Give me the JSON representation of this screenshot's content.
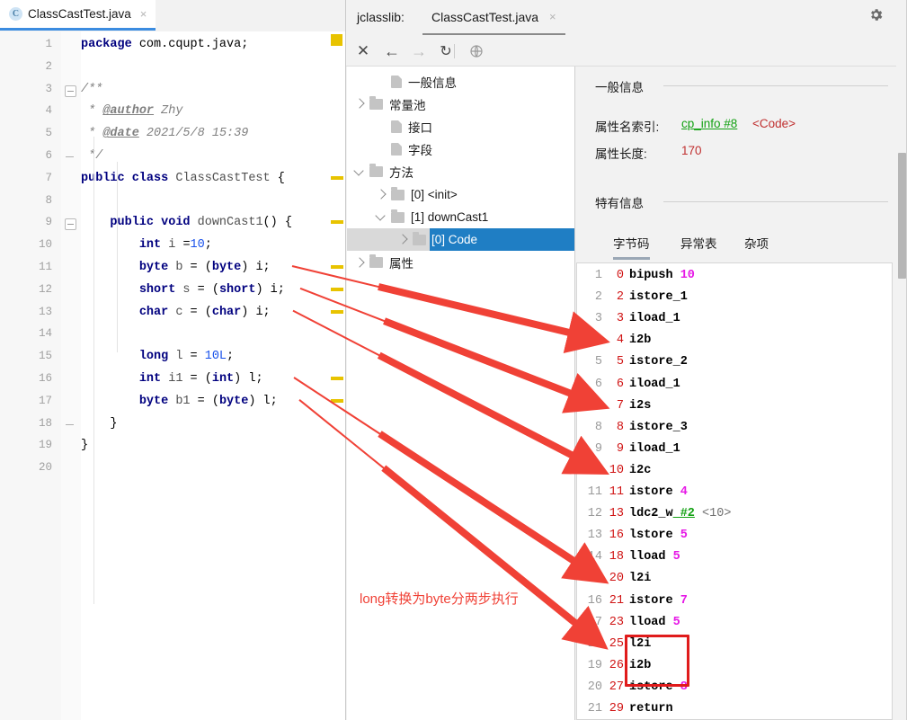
{
  "editor": {
    "tab": {
      "label": "ClassCastTest.java",
      "icon": "class-icon",
      "letter": "C",
      "close": "×"
    },
    "line_numbers": [
      "1",
      "2",
      "3",
      "4",
      "5",
      "6",
      "7",
      "8",
      "9",
      "10",
      "11",
      "12",
      "13",
      "14",
      "15",
      "16",
      "17",
      "18",
      "19",
      "20"
    ],
    "code_lines": [
      {
        "n": 1,
        "segs": [
          {
            "t": "package",
            "c": "kw"
          },
          {
            "t": " com.cqupt.java;",
            "c": "pl"
          }
        ]
      },
      {
        "n": 2,
        "segs": []
      },
      {
        "n": 3,
        "segs": [
          {
            "t": "/**",
            "c": "cmt"
          }
        ]
      },
      {
        "n": 4,
        "segs": [
          {
            "t": " * ",
            "c": "cmt"
          },
          {
            "t": "@author",
            "c": "cmt-u"
          },
          {
            "t": " Zhy",
            "c": "cmt"
          }
        ]
      },
      {
        "n": 5,
        "segs": [
          {
            "t": " * ",
            "c": "cmt"
          },
          {
            "t": "@date",
            "c": "cmt-u"
          },
          {
            "t": " 2021/5/8 15:39",
            "c": "cmt"
          }
        ]
      },
      {
        "n": 6,
        "segs": [
          {
            "t": " */",
            "c": "cmt"
          }
        ]
      },
      {
        "n": 7,
        "segs": [
          {
            "t": "public class",
            "c": "kw"
          },
          {
            "t": " ClassCastTest ",
            "c": "id"
          },
          {
            "t": "{",
            "c": "pl"
          }
        ]
      },
      {
        "n": 8,
        "segs": []
      },
      {
        "n": 9,
        "segs": [
          {
            "t": "    ",
            "c": "pl"
          },
          {
            "t": "public void",
            "c": "kw"
          },
          {
            "t": " downCast1",
            "c": "id"
          },
          {
            "t": "() {",
            "c": "pl"
          }
        ]
      },
      {
        "n": 10,
        "segs": [
          {
            "t": "        ",
            "c": "pl"
          },
          {
            "t": "int",
            "c": "kw"
          },
          {
            "t": " i ",
            "c": "id"
          },
          {
            "t": "=",
            "c": "pl"
          },
          {
            "t": "10",
            "c": "num"
          },
          {
            "t": ";",
            "c": "pl"
          }
        ]
      },
      {
        "n": 11,
        "segs": [
          {
            "t": "        ",
            "c": "pl"
          },
          {
            "t": "byte",
            "c": "kw"
          },
          {
            "t": " b ",
            "c": "id"
          },
          {
            "t": "= (",
            "c": "pl"
          },
          {
            "t": "byte",
            "c": "kw"
          },
          {
            "t": ") i;",
            "c": "pl"
          }
        ]
      },
      {
        "n": 12,
        "segs": [
          {
            "t": "        ",
            "c": "pl"
          },
          {
            "t": "short",
            "c": "kw"
          },
          {
            "t": " s ",
            "c": "id"
          },
          {
            "t": "= (",
            "c": "pl"
          },
          {
            "t": "short",
            "c": "kw"
          },
          {
            "t": ") i;",
            "c": "pl"
          }
        ]
      },
      {
        "n": 13,
        "segs": [
          {
            "t": "        ",
            "c": "pl"
          },
          {
            "t": "char",
            "c": "kw"
          },
          {
            "t": " c ",
            "c": "id"
          },
          {
            "t": "= (",
            "c": "pl"
          },
          {
            "t": "char",
            "c": "kw"
          },
          {
            "t": ") i;",
            "c": "pl"
          }
        ]
      },
      {
        "n": 14,
        "segs": []
      },
      {
        "n": 15,
        "segs": [
          {
            "t": "        ",
            "c": "pl"
          },
          {
            "t": "long",
            "c": "kw"
          },
          {
            "t": " l ",
            "c": "id"
          },
          {
            "t": "= ",
            "c": "pl"
          },
          {
            "t": "10L",
            "c": "num"
          },
          {
            "t": ";",
            "c": "pl"
          }
        ]
      },
      {
        "n": 16,
        "segs": [
          {
            "t": "        ",
            "c": "pl"
          },
          {
            "t": "int",
            "c": "kw"
          },
          {
            "t": " i1 ",
            "c": "id"
          },
          {
            "t": "= (",
            "c": "pl"
          },
          {
            "t": "int",
            "c": "kw"
          },
          {
            "t": ") l;",
            "c": "pl"
          }
        ]
      },
      {
        "n": 17,
        "segs": [
          {
            "t": "        ",
            "c": "pl"
          },
          {
            "t": "byte",
            "c": "kw"
          },
          {
            "t": " b1 ",
            "c": "id"
          },
          {
            "t": "= (",
            "c": "pl"
          },
          {
            "t": "byte",
            "c": "kw"
          },
          {
            "t": ") l;",
            "c": "pl"
          }
        ]
      },
      {
        "n": 18,
        "segs": [
          {
            "t": "    }",
            "c": "pl"
          }
        ]
      },
      {
        "n": 19,
        "segs": [
          {
            "t": "}",
            "c": "pl"
          }
        ]
      },
      {
        "n": 20,
        "segs": []
      }
    ],
    "caret_line": 20,
    "gutter_marker_color": "#e8c300"
  },
  "jclasslib": {
    "title": "jclasslib:",
    "file_tab": {
      "label": "ClassCastTest.java",
      "close": "×"
    },
    "window_buttons": [
      {
        "name": "settings",
        "icon": "gear-icon"
      },
      {
        "name": "minimize",
        "icon": "minimize-icon"
      }
    ],
    "toolbar": [
      {
        "name": "close",
        "icon": "close-icon",
        "glyph": "✕",
        "enabled": true
      },
      {
        "name": "back",
        "icon": "arrow-left-icon",
        "glyph": "←",
        "enabled": true
      },
      {
        "name": "forward",
        "icon": "arrow-right-icon",
        "glyph": "→",
        "enabled": false
      },
      {
        "name": "reload",
        "icon": "refresh-icon",
        "glyph": "↻",
        "enabled": true
      },
      {
        "name": "browse",
        "icon": "globe-icon",
        "glyph": "◌",
        "enabled": true
      }
    ],
    "tree": [
      {
        "label": "一般信息",
        "indent": 1,
        "twisty": "none",
        "icon": "doc",
        "selected": false
      },
      {
        "label": "常量池",
        "indent": 0,
        "twisty": "right",
        "icon": "folder",
        "selected": false
      },
      {
        "label": "接口",
        "indent": 1,
        "twisty": "none",
        "icon": "doc",
        "selected": false
      },
      {
        "label": "字段",
        "indent": 1,
        "twisty": "none",
        "icon": "doc",
        "selected": false
      },
      {
        "label": "方法",
        "indent": 0,
        "twisty": "down",
        "icon": "folder",
        "selected": false
      },
      {
        "label": "[0] <init>",
        "indent": 1,
        "twisty": "right",
        "icon": "folder",
        "selected": false
      },
      {
        "label": "[1] downCast1",
        "indent": 1,
        "twisty": "down",
        "icon": "folder",
        "selected": false
      },
      {
        "label": "[0] Code",
        "indent": 2,
        "twisty": "right",
        "icon": "folder",
        "selected": true
      },
      {
        "label": "属性",
        "indent": 0,
        "twisty": "right",
        "icon": "folder",
        "selected": false
      }
    ],
    "detail": {
      "general_section": "一般信息",
      "attr_name_label": "属性名索引:",
      "attr_name_link": "cp_info #8",
      "attr_name_value": "<Code>",
      "attr_len_label": "属性长度:",
      "attr_len_value": "170",
      "specific_section": "特有信息",
      "tabs": [
        {
          "label": "字节码",
          "active": true
        },
        {
          "label": "异常表",
          "active": false
        },
        {
          "label": "杂项",
          "active": false
        }
      ]
    },
    "bytecode": [
      {
        "no": "1",
        "off": "0",
        "op": "bipush",
        "arg": "10",
        "ref": "",
        "cmt": ""
      },
      {
        "no": "2",
        "off": "2",
        "op": "istore_1",
        "arg": "",
        "ref": "",
        "cmt": ""
      },
      {
        "no": "3",
        "off": "3",
        "op": "iload_1",
        "arg": "",
        "ref": "",
        "cmt": ""
      },
      {
        "no": "4",
        "off": "4",
        "op": "i2b",
        "arg": "",
        "ref": "",
        "cmt": ""
      },
      {
        "no": "5",
        "off": "5",
        "op": "istore_2",
        "arg": "",
        "ref": "",
        "cmt": ""
      },
      {
        "no": "6",
        "off": "6",
        "op": "iload_1",
        "arg": "",
        "ref": "",
        "cmt": ""
      },
      {
        "no": "7",
        "off": "7",
        "op": "i2s",
        "arg": "",
        "ref": "",
        "cmt": ""
      },
      {
        "no": "8",
        "off": "8",
        "op": "istore_3",
        "arg": "",
        "ref": "",
        "cmt": ""
      },
      {
        "no": "9",
        "off": "9",
        "op": "iload_1",
        "arg": "",
        "ref": "",
        "cmt": ""
      },
      {
        "no": "10",
        "off": "10",
        "op": "i2c",
        "arg": "",
        "ref": "",
        "cmt": ""
      },
      {
        "no": "11",
        "off": "11",
        "op": "istore",
        "arg": "4",
        "ref": "",
        "cmt": ""
      },
      {
        "no": "12",
        "off": "13",
        "op": "ldc2_w",
        "arg": "",
        "ref": "#2",
        "cmt": "<10>"
      },
      {
        "no": "13",
        "off": "16",
        "op": "lstore",
        "arg": "5",
        "ref": "",
        "cmt": ""
      },
      {
        "no": "14",
        "off": "18",
        "op": "lload",
        "arg": "5",
        "ref": "",
        "cmt": ""
      },
      {
        "no": "15",
        "off": "20",
        "op": "l2i",
        "arg": "",
        "ref": "",
        "cmt": ""
      },
      {
        "no": "16",
        "off": "21",
        "op": "istore",
        "arg": "7",
        "ref": "",
        "cmt": ""
      },
      {
        "no": "17",
        "off": "23",
        "op": "lload",
        "arg": "5",
        "ref": "",
        "cmt": ""
      },
      {
        "no": "18",
        "off": "25",
        "op": "l2i",
        "arg": "",
        "ref": "",
        "cmt": ""
      },
      {
        "no": "19",
        "off": "26",
        "op": "i2b",
        "arg": "",
        "ref": "",
        "cmt": ""
      },
      {
        "no": "20",
        "off": "27",
        "op": "istore",
        "arg": "8",
        "ref": "",
        "cmt": ""
      },
      {
        "no": "21",
        "off": "29",
        "op": "return",
        "arg": "",
        "ref": "",
        "cmt": ""
      }
    ],
    "highlight_box": {
      "from_line": 18,
      "to_line": 19,
      "color": "#e01b1b"
    }
  },
  "annotations": {
    "color": "#f04136",
    "note": "long转换为byte分两步执行",
    "arrows": [
      {
        "from_code_line": 11,
        "to_bytecode_offset": "4"
      },
      {
        "from_code_line": 12,
        "to_bytecode_offset": "7"
      },
      {
        "from_code_line": 13,
        "to_bytecode_offset": "10"
      },
      {
        "from_code_line": 16,
        "to_bytecode_offset": "20"
      },
      {
        "from_code_line": 17,
        "to_bytecode_offset": "25"
      }
    ]
  }
}
